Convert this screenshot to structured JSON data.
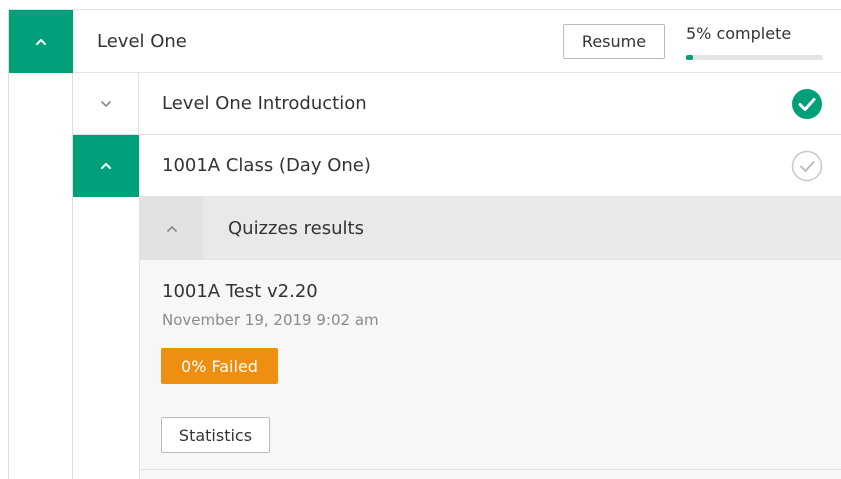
{
  "level": {
    "title": "Level One",
    "resume_label": "Resume",
    "progress_text": "5% complete",
    "progress_percent": 5
  },
  "topics": [
    {
      "title": "Level One Introduction",
      "status": "completed"
    },
    {
      "title": "1001A Class (Day One)",
      "status": "incomplete"
    }
  ],
  "quizzes": {
    "header": "Quizzes results",
    "items": [
      {
        "name": "1001A Test v2.20",
        "date": "November 19, 2019 9:02 am",
        "result": "0% Failed",
        "statistics_label": "Statistics"
      }
    ]
  },
  "colors": {
    "accent": "#00a07a",
    "failed": "#ef8f12"
  },
  "icons": {
    "expand": "chevron-up-icon",
    "collapse": "chevron-down-icon",
    "completed": "check-circle-filled-icon",
    "incomplete": "check-circle-outline-icon"
  }
}
